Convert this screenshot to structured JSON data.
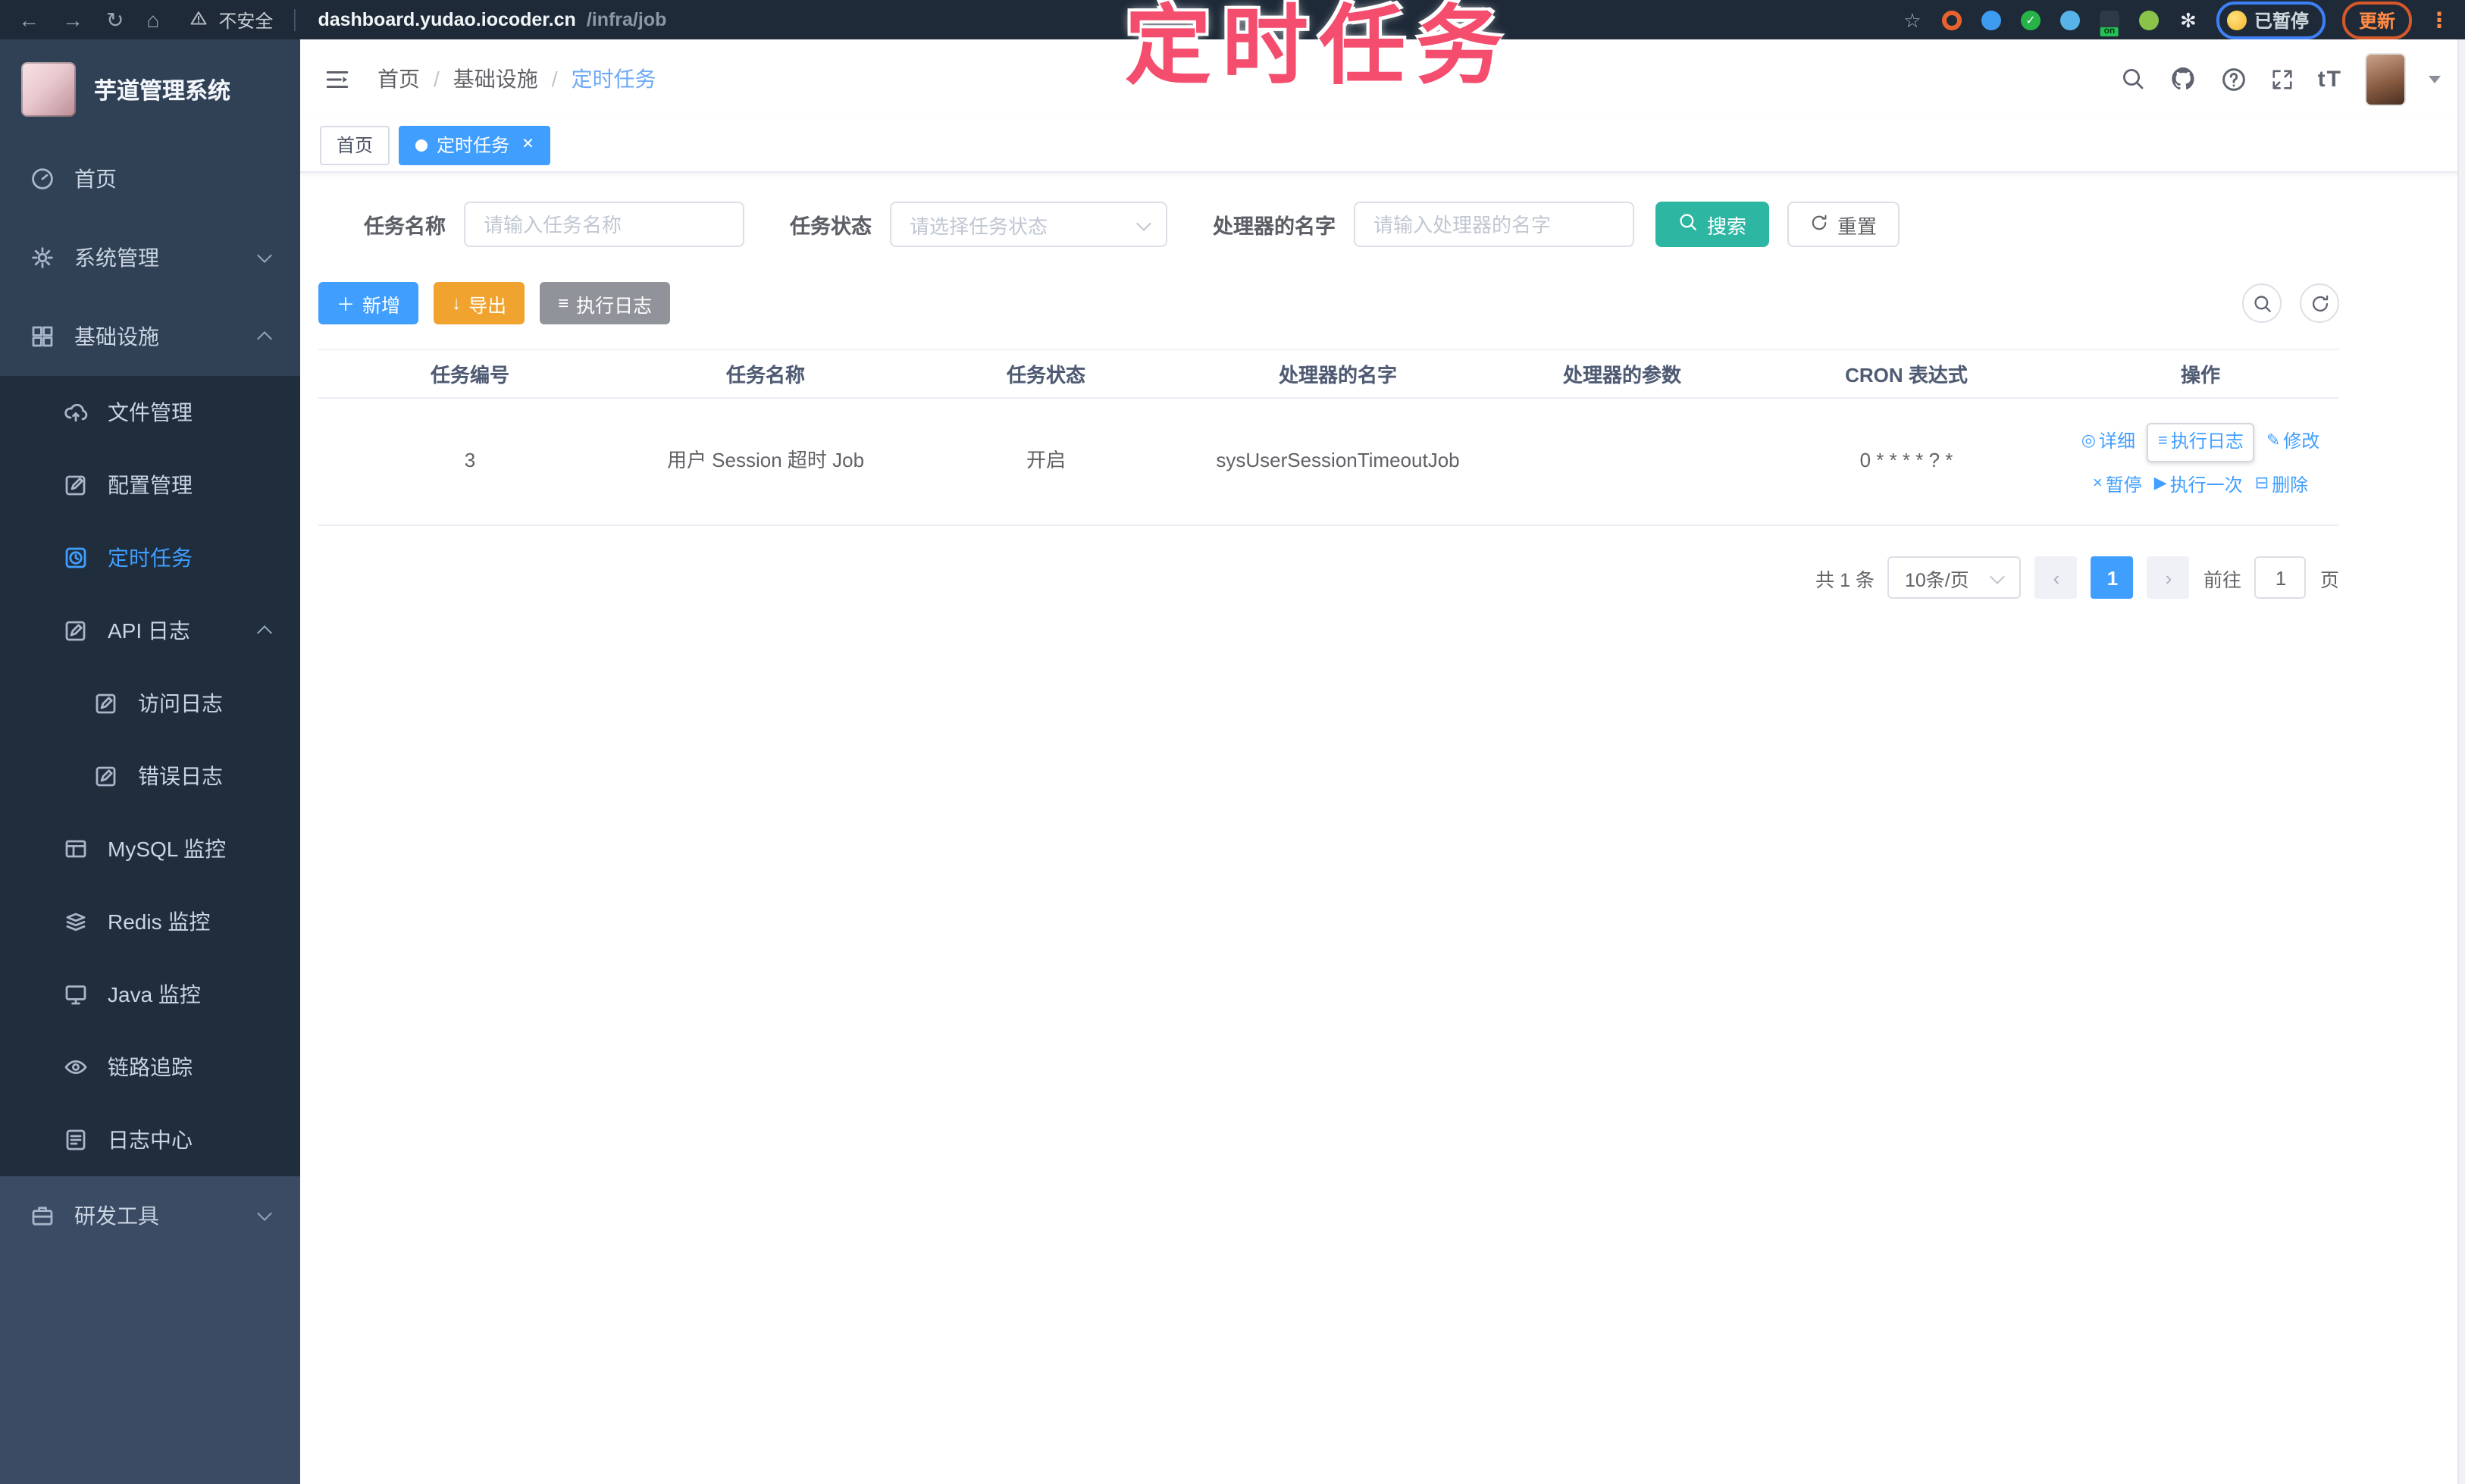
{
  "browser": {
    "security_label": "不安全",
    "url_domain": "dashboard.yudao.iocoder.cn",
    "url_path": "/infra/job",
    "paused_badge": "已暂停",
    "update_button": "更新",
    "extensions": [
      {
        "name": "bookmark-star-icon",
        "type": "glyph",
        "glyph": "☆",
        "color": "#a8b2bd"
      },
      {
        "name": "ext-orange-ring-icon",
        "type": "ring",
        "color": "#e8622d"
      },
      {
        "name": "ext-blue-drop-icon",
        "type": "circle",
        "color": "#3d9bf0",
        "glyph": ""
      },
      {
        "name": "ext-green-check-icon",
        "type": "circle",
        "color": "#27b24a",
        "glyph": "✓"
      },
      {
        "name": "ext-blue-grid-icon",
        "type": "circle",
        "color": "#57b3e8",
        "glyph": ""
      },
      {
        "name": "ext-dark-on-icon",
        "type": "square",
        "color": "#2d3a45",
        "badge": "on"
      },
      {
        "name": "ext-green-leaf-icon",
        "type": "circle",
        "color": "#8bc34a",
        "glyph": ""
      },
      {
        "name": "ext-paw-icon",
        "type": "glyph",
        "glyph": "✻",
        "color": "#e8edf2"
      }
    ]
  },
  "annotation": {
    "text": "定时任务"
  },
  "app": {
    "title": "芋道管理系统"
  },
  "sidebar": {
    "items": [
      {
        "id": "home",
        "label": "首页",
        "icon": "gauge",
        "level": 0,
        "section": "top"
      },
      {
        "id": "system",
        "label": "系统管理",
        "icon": "gear",
        "level": 0,
        "section": "top",
        "arrow": "down"
      },
      {
        "id": "infra",
        "label": "基础设施",
        "icon": "grid",
        "level": 0,
        "section": "top",
        "arrow": "up"
      },
      {
        "id": "file",
        "label": "文件管理",
        "icon": "cloud",
        "level": 1,
        "section": "sub"
      },
      {
        "id": "config",
        "label": "配置管理",
        "icon": "editsq",
        "level": 1,
        "section": "sub"
      },
      {
        "id": "job",
        "label": "定时任务",
        "icon": "clocksq",
        "level": 1,
        "section": "sub",
        "active": true
      },
      {
        "id": "api-log",
        "label": "API 日志",
        "icon": "pendoc",
        "level": 1,
        "section": "sub",
        "arrow": "up"
      },
      {
        "id": "access-log",
        "label": "访问日志",
        "icon": "pendoc",
        "level": 2,
        "section": "sub"
      },
      {
        "id": "error-log",
        "label": "错误日志",
        "icon": "pendoc",
        "level": 2,
        "section": "sub"
      },
      {
        "id": "mysql",
        "label": "MySQL 监控",
        "icon": "mysql",
        "level": 1,
        "section": "sub"
      },
      {
        "id": "redis",
        "label": "Redis 监控",
        "icon": "redis",
        "level": 1,
        "section": "sub"
      },
      {
        "id": "java",
        "label": "Java 监控",
        "icon": "java",
        "level": 1,
        "section": "sub"
      },
      {
        "id": "trace",
        "label": "链路追踪",
        "icon": "eye",
        "level": 1,
        "section": "sub"
      },
      {
        "id": "log-center",
        "label": "日志中心",
        "icon": "logdoc",
        "level": 1,
        "section": "sub"
      },
      {
        "id": "dev-tools",
        "label": "研发工具",
        "icon": "briefcase",
        "level": 0,
        "section": "tools",
        "arrow": "down"
      }
    ]
  },
  "breadcrumb": {
    "items": [
      "首页",
      "基础设施",
      "定时任务"
    ],
    "separator": "/"
  },
  "tabs": [
    {
      "label": "首页",
      "active": false,
      "closable": false
    },
    {
      "label": "定时任务",
      "active": true,
      "closable": true
    }
  ],
  "filters": {
    "name_label": "任务名称",
    "name_placeholder": "请输入任务名称",
    "status_label": "任务状态",
    "status_placeholder": "请选择任务状态",
    "handler_label": "处理器的名字",
    "handler_placeholder": "请输入处理器的名字",
    "search_label": "搜索",
    "reset_label": "重置"
  },
  "toolbar": {
    "add_label": "新增",
    "export_label": "导出",
    "exec_log_label": "执行日志"
  },
  "table": {
    "headers": [
      "任务编号",
      "任务名称",
      "任务状态",
      "处理器的名字",
      "处理器的参数",
      "CRON 表达式",
      "操作"
    ],
    "rows": [
      {
        "id": "3",
        "name": "用户 Session 超时 Job",
        "status": "开启",
        "handler": "sysUserSessionTimeoutJob",
        "params": "",
        "cron": "0 * * * * ? *",
        "ops_line1": [
          {
            "label": "详细",
            "icon": "eye"
          },
          {
            "label": "执行日志",
            "icon": "list",
            "focused": true
          },
          {
            "label": "修改",
            "icon": "edit"
          }
        ],
        "ops_line2": [
          {
            "label": "暂停",
            "icon": "pause"
          },
          {
            "label": "执行一次",
            "icon": "play"
          },
          {
            "label": "删除",
            "icon": "trash"
          }
        ]
      }
    ]
  },
  "pagination": {
    "total": "共 1 条",
    "page_size": "10条/页",
    "page": "1",
    "goto_label": "前往",
    "goto_value": "1",
    "page_suffix": "页"
  },
  "icons": {
    "back": "←",
    "forward": "→",
    "reload": "↻",
    "home": "⌂",
    "sep": "│",
    "plus": "＋",
    "download": "↓",
    "list": "≡",
    "eye": "◎",
    "edit": "✎",
    "pause": "×",
    "play": "▶",
    "trash": "⊟",
    "dots": "⋮",
    "close": "✕",
    "check": "✓"
  },
  "colors": {
    "accent": "#409eff",
    "search": "#2db7a3",
    "export": "#f0a32f",
    "gray": "#909399",
    "annotation": "#f44d6e"
  }
}
